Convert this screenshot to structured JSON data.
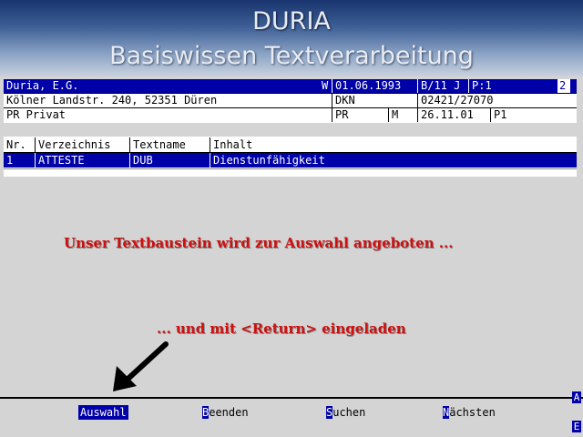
{
  "title": {
    "line1": "DURIA",
    "line2": "Basiswissen Textverarbeitung"
  },
  "header": {
    "row1": {
      "name": "Duria, E.G.",
      "flag": "W",
      "date": "01.06.1993",
      "code": "B/11 J",
      "page": "P:1",
      "num": "2"
    },
    "row2": {
      "address": "Kölner Landstr. 240, 52351 Düren",
      "org": "DKN",
      "phone": "02421/27070"
    },
    "row3": {
      "type": "PR Privat",
      "abbr": "PR",
      "gender": "M",
      "date": "26.11.01",
      "code": "P1"
    }
  },
  "list": {
    "columns": [
      "Nr.",
      "Verzeichnis",
      "Textname",
      "Inhalt"
    ],
    "rows": [
      {
        "nr": "1",
        "verzeichnis": "ATTESTE",
        "textname": "DUB",
        "inhalt": "Dienstunfähigkeit"
      }
    ]
  },
  "messages": {
    "line1": "Unser Textbaustein wird zur Auswahl angeboten ...",
    "line2": "... und mit <Return> eingeladen"
  },
  "function_keys": {
    "auswahl": "Auswahl",
    "beenden_hot": "B",
    "beenden_rest": "eenden",
    "suchen_hot": "S",
    "suchen_rest": "uchen",
    "naechsten_hot": "N",
    "naechsten_rest": "ächsten"
  },
  "side": {
    "top": "A",
    "bottom": "E"
  },
  "icons": {
    "pointer": "arrow-down-left-icon"
  },
  "colors": {
    "selection": "#0000a8",
    "message": "#cc1010"
  }
}
